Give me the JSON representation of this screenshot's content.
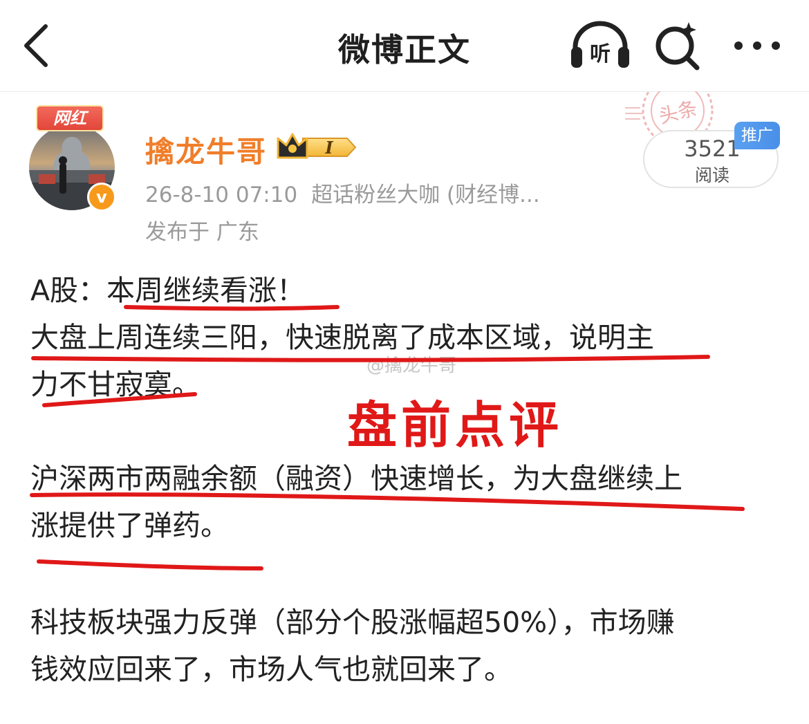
{
  "header": {
    "title": "微博正文",
    "listen_label": "听"
  },
  "post": {
    "stamp_text": "头条",
    "read_count": "3521",
    "read_label": "阅读",
    "promo_tag": "推广",
    "author": {
      "badge": "网红",
      "name": "擒龙牛哥",
      "level": "I",
      "verified_mark": "v"
    },
    "datetime": "26-8-10 07:10",
    "source": "超话粉丝大咖 (财经博...",
    "location": "发布于 广东",
    "overlay_title": "盘前点评",
    "watermark": "@擒龙牛哥",
    "paragraphs": [
      {
        "lines": [
          "A股：本周继续看涨！",
          "大盘上周连续三阳，快速脱离了成本区域，说明主",
          "力不甘寂寞。"
        ]
      },
      {
        "lines": [
          "沪深两市两融余额（融资）快速增长，为大盘继续上",
          "涨提供了弹药。"
        ]
      },
      {
        "lines": [
          "科技板块强力反弹（部分个股涨幅超50%），市场赚",
          "钱效应回来了，市场人气也就回来了。"
        ]
      }
    ]
  },
  "colors": {
    "author_name": "#f07e2a",
    "annotation_red": "#e01818",
    "promo_blue": "#4a8fe8",
    "verified_orange": "#f79a1b"
  },
  "icons": [
    "back-arrow-icon",
    "headphones-icon",
    "search-icon",
    "more-icon",
    "crown-icon"
  ]
}
